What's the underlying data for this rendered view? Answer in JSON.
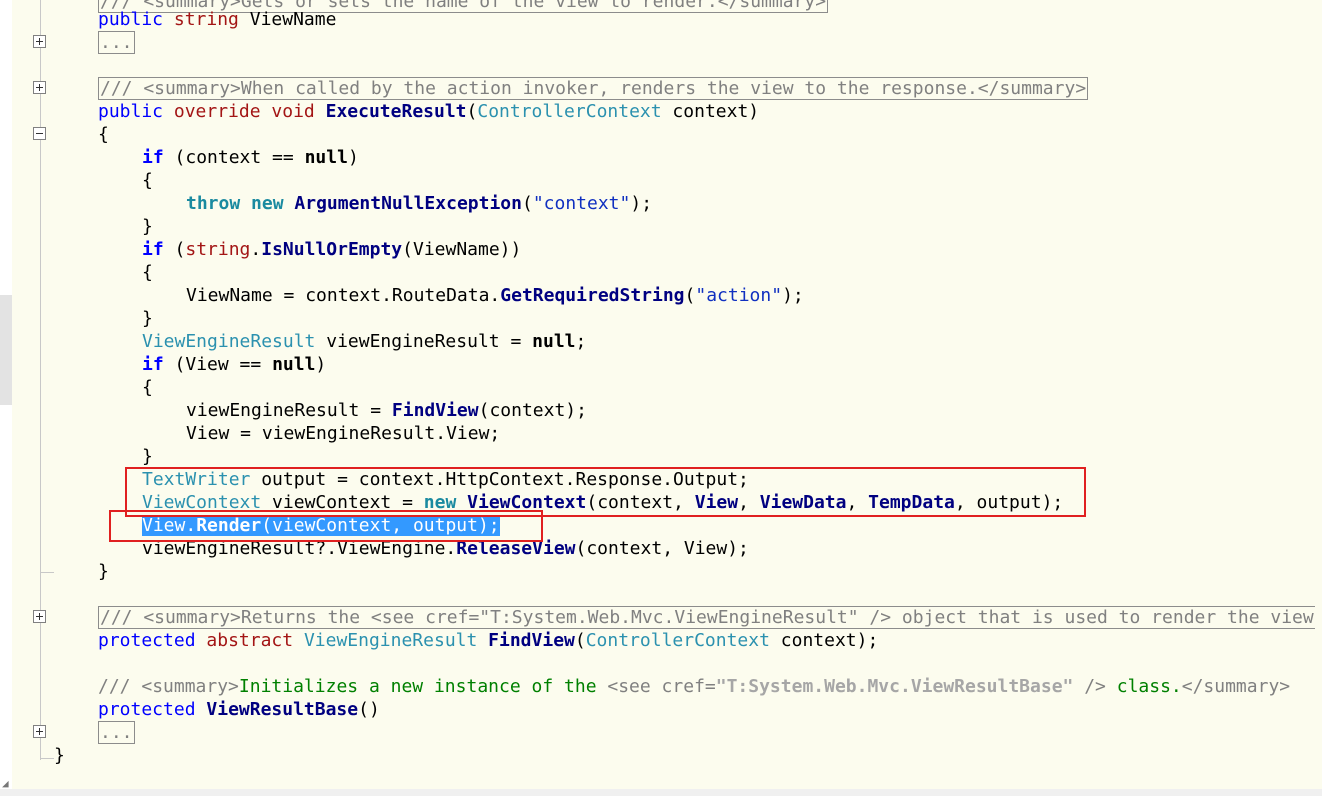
{
  "editor": {
    "colors": {
      "background": "#fcfcee",
      "keyword": "#0000ff",
      "type": "#2b91af",
      "string": "#a31515",
      "comment": "#008000",
      "highlight_box": "#e02020",
      "selection": "#3399ff"
    },
    "lines": {
      "l00": {
        "doc": "/// <summary>Gets or sets the name of the view to render.</summary>"
      },
      "l01": {
        "kw": "public",
        "type": "string",
        "name": " ViewName"
      },
      "l02": {
        "collapsed": "..."
      },
      "l04": {
        "doc": "/// <summary>When called by the action invoker, renders the view to the response.</summary>"
      },
      "l05": {
        "kw": "public",
        "kw2": "override",
        "kw3": "void",
        "method": "ExecuteResult",
        "open": "(",
        "type": "ControllerContext",
        "rest": " context)"
      },
      "l06": {
        "text": "{"
      },
      "l07": {
        "kw": "if",
        "open": " (context == ",
        "null": "null",
        "close": ")"
      },
      "l08": {
        "text": "{"
      },
      "l09": {
        "kw": "throw",
        "kw2": "new",
        "type": "ArgumentNullException",
        "open": "(",
        "str": "\"context\"",
        "close": ");"
      },
      "l10": {
        "text": "}"
      },
      "l11": {
        "kw": "if",
        "open": " (",
        "type": "string",
        "dot": ".",
        "method": "IsNullOrEmpty",
        "rest": "(ViewName))"
      },
      "l12": {
        "text": "{"
      },
      "l13": {
        "text": "ViewName = context.RouteData.",
        "method": "GetRequiredString",
        "open": "(",
        "str": "\"action\"",
        "close": ");"
      },
      "l14": {
        "text": "}"
      },
      "l15": {
        "type": "ViewEngineResult",
        "text": " viewEngineResult = ",
        "null": "null",
        "close": ";"
      },
      "l16": {
        "kw": "if",
        "open": " (View == ",
        "null": "null",
        "close": ")"
      },
      "l17": {
        "text": "{"
      },
      "l18": {
        "text": "viewEngineResult = ",
        "method": "FindView",
        "rest": "(context);"
      },
      "l19": {
        "text": "View = viewEngineResult.View;"
      },
      "l20": {
        "text": "}"
      },
      "l21": {
        "type": "TextWriter",
        "text": " output = context.HttpContext.Response.Output;"
      },
      "l22": {
        "type": "ViewContext",
        "text": " viewContext = ",
        "kw": "new",
        "type2": "ViewContext",
        "open": "(context, ",
        "p1": "View",
        "c1": ", ",
        "p2": "ViewData",
        "c2": ", ",
        "p3": "TempData",
        "close": ", output);"
      },
      "l23": {
        "p": "View",
        "dot": ".",
        "method": "Render",
        "rest": "(viewContext, output);"
      },
      "l24": {
        "text": "viewEngineResult?.ViewEngine.",
        "method": "ReleaseView",
        "rest": "(context, View);"
      },
      "l25": {
        "text": "}"
      },
      "l27": {
        "doc": "/// <summary>Returns the <see cref=\"T:System.Web.Mvc.ViewEngineResult\" /> object that is used to render the view"
      },
      "l28": {
        "kw": "protected",
        "kw2": "abstract",
        "type": "ViewEngineResult",
        "method": "FindView",
        "open": "(",
        "type2": "ControllerContext",
        "rest": " context);"
      },
      "l30": {
        "slashes": "/// ",
        "tag_open": "<summary>",
        "text1": "Initializes a new instance of the ",
        "see_open": "<see cref=",
        "cref": "\"T:System.Web.Mvc.ViewResultBase\"",
        "see_close": " />",
        "text2": " class.",
        "tag_close": "</summary>"
      },
      "l31": {
        "kw": "protected",
        "method": "ViewResultBase",
        "rest": "()"
      },
      "l32": {
        "collapsed": "..."
      },
      "l33": {
        "text": "}"
      }
    }
  }
}
